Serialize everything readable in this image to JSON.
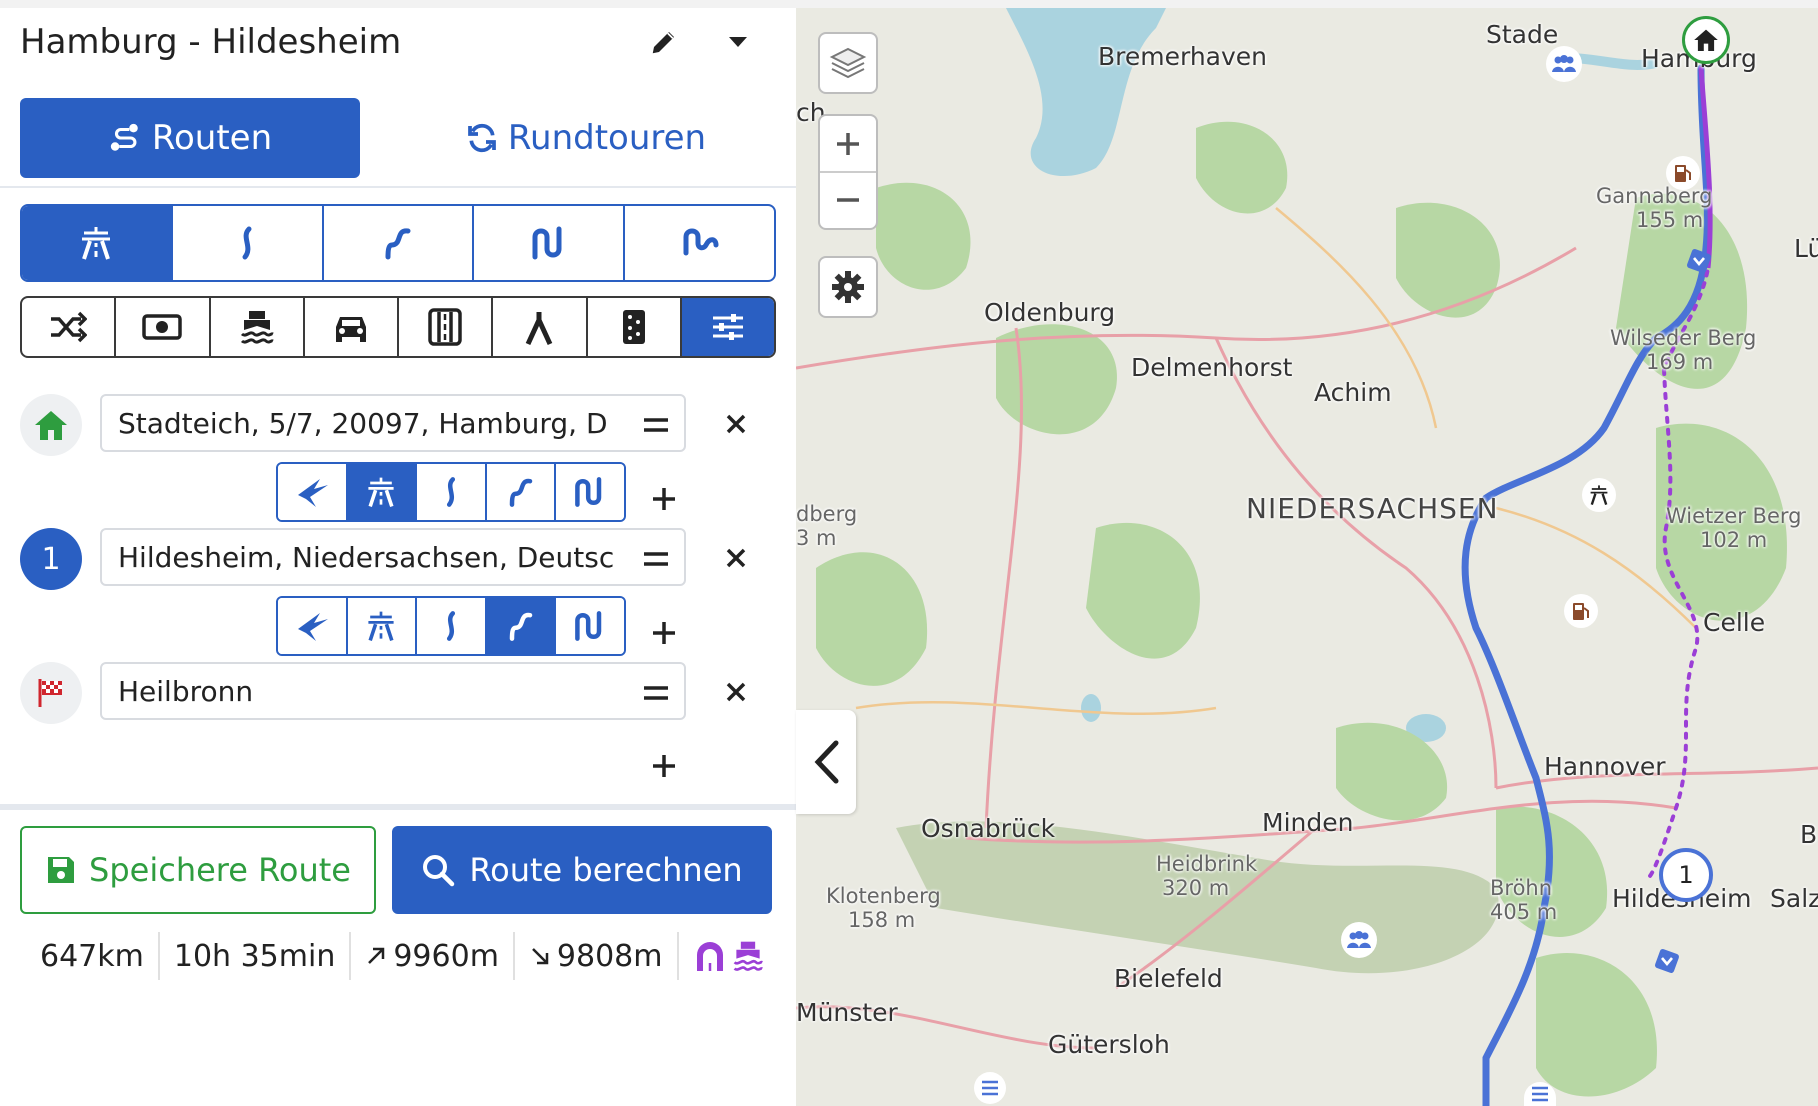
{
  "header": {
    "title": "Hamburg - Hildesheim"
  },
  "tabs": [
    {
      "label": "Routen",
      "active": true
    },
    {
      "label": "Rundtouren",
      "active": false
    }
  ],
  "modes": [
    "highway-icon",
    "curvy-icon",
    "curvier-icon",
    "twisty-icon",
    "extra-twisty-icon"
  ],
  "options": [
    "shuffle-icon",
    "toll-icon",
    "ferry-icon",
    "car-icon",
    "tunnel-icon",
    "unpaved-icon",
    "dirt-road-icon",
    "settings-sliders-icon"
  ],
  "waypoints": [
    {
      "value": "Stadteich, 5/7, 20097, Hamburg, D",
      "marker": "home-icon"
    },
    {
      "value": "Hildesheim, Niedersachsen, Deutsc",
      "marker": "1"
    },
    {
      "value": "Heilbronn",
      "marker": "flag-icon"
    }
  ],
  "actions": {
    "save": "Speichere Route",
    "calculate": "Route berechnen"
  },
  "stats": {
    "distance": "647km",
    "duration": "10h 35min",
    "ascent": "9960m",
    "descent": "9808m"
  },
  "colors": {
    "primary": "#2a5fc2",
    "save_green": "#2e9d3f",
    "route_blue": "#4a72d6",
    "route_purple": "#9b3fd6"
  },
  "map": {
    "places": {
      "bremerhaven": "Bremerhaven",
      "stade": "Stade",
      "hamburg": "Hamburg",
      "oldenburg": "Oldenburg",
      "delmenhorst": "Delmenhorst",
      "achim": "Achim",
      "niedersachsen": "NIEDERSACHSEN",
      "celle": "Celle",
      "hannover": "Hannover",
      "osnabrueck": "Osnabrück",
      "minden": "Minden",
      "hildesheim": "Hildesheim",
      "bielefeld": "Bielefeld",
      "guetersloh": "Gütersloh",
      "muenster": "Münster",
      "salz": "Salz",
      "lue": "Lü",
      "ch": "ch",
      "b": "B",
      "dberg": "dberg",
      "dberg_m": "3 m"
    },
    "peaks": {
      "gannaberg": "Gannaberg",
      "gannaberg_elev": "155 m",
      "wilseder": "Wilseder Berg",
      "wilseder_elev": "169 m",
      "wietzer": "Wietzer Berg",
      "wietzer_elev": "102 m",
      "heidbrink": "Heidbrink",
      "heidbrink_elev": "320 m",
      "klotenberg": "Klotenberg",
      "klotenberg_elev": "158 m",
      "broehn": "Bröhn",
      "broehn_elev": "405 m"
    },
    "waypoint_number": "1"
  }
}
